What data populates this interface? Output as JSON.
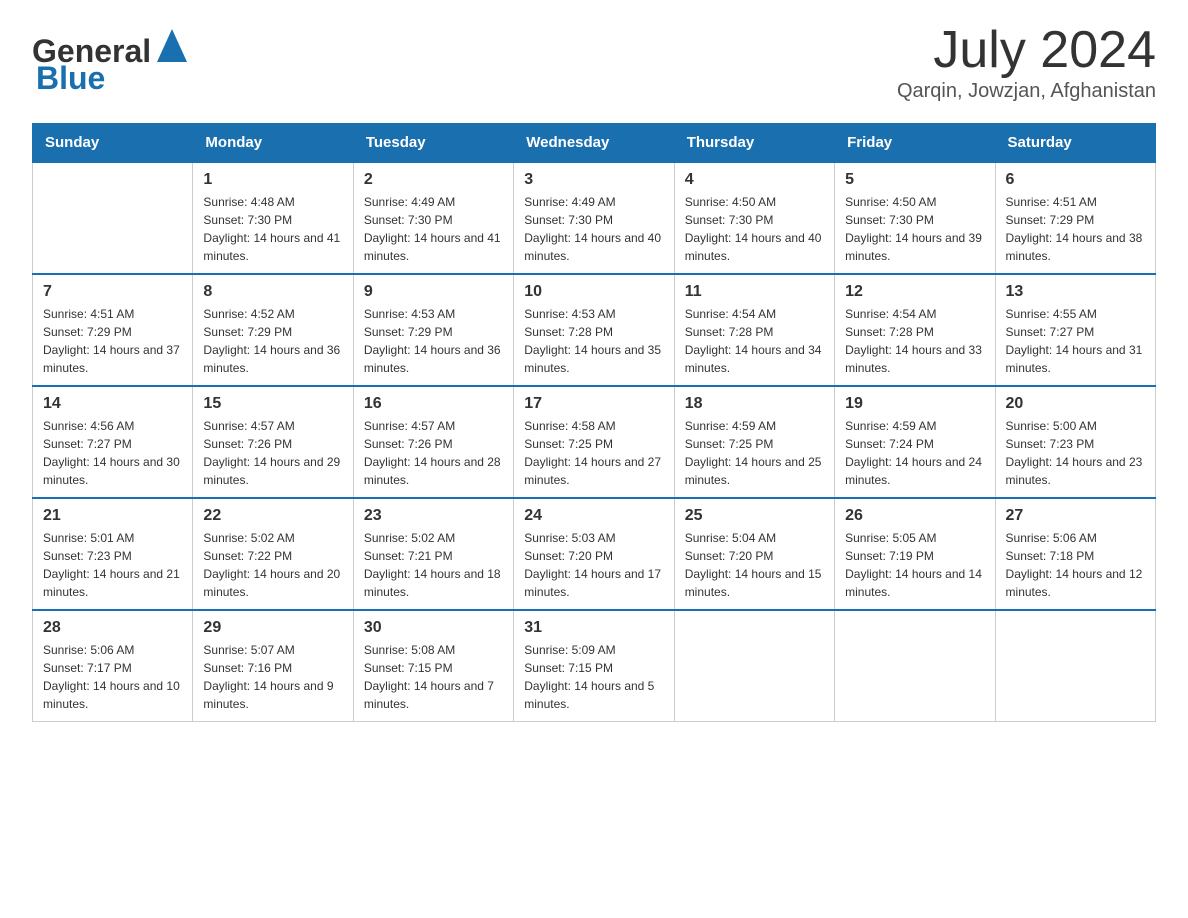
{
  "logo": {
    "text_general": "General",
    "text_blue": "Blue"
  },
  "title": {
    "month_year": "July 2024",
    "location": "Qarqin, Jowzjan, Afghanistan"
  },
  "days_of_week": [
    "Sunday",
    "Monday",
    "Tuesday",
    "Wednesday",
    "Thursday",
    "Friday",
    "Saturday"
  ],
  "weeks": [
    [
      {
        "day": "",
        "sunrise": "",
        "sunset": "",
        "daylight": ""
      },
      {
        "day": "1",
        "sunrise": "Sunrise: 4:48 AM",
        "sunset": "Sunset: 7:30 PM",
        "daylight": "Daylight: 14 hours and 41 minutes."
      },
      {
        "day": "2",
        "sunrise": "Sunrise: 4:49 AM",
        "sunset": "Sunset: 7:30 PM",
        "daylight": "Daylight: 14 hours and 41 minutes."
      },
      {
        "day": "3",
        "sunrise": "Sunrise: 4:49 AM",
        "sunset": "Sunset: 7:30 PM",
        "daylight": "Daylight: 14 hours and 40 minutes."
      },
      {
        "day": "4",
        "sunrise": "Sunrise: 4:50 AM",
        "sunset": "Sunset: 7:30 PM",
        "daylight": "Daylight: 14 hours and 40 minutes."
      },
      {
        "day": "5",
        "sunrise": "Sunrise: 4:50 AM",
        "sunset": "Sunset: 7:30 PM",
        "daylight": "Daylight: 14 hours and 39 minutes."
      },
      {
        "day": "6",
        "sunrise": "Sunrise: 4:51 AM",
        "sunset": "Sunset: 7:29 PM",
        "daylight": "Daylight: 14 hours and 38 minutes."
      }
    ],
    [
      {
        "day": "7",
        "sunrise": "Sunrise: 4:51 AM",
        "sunset": "Sunset: 7:29 PM",
        "daylight": "Daylight: 14 hours and 37 minutes."
      },
      {
        "day": "8",
        "sunrise": "Sunrise: 4:52 AM",
        "sunset": "Sunset: 7:29 PM",
        "daylight": "Daylight: 14 hours and 36 minutes."
      },
      {
        "day": "9",
        "sunrise": "Sunrise: 4:53 AM",
        "sunset": "Sunset: 7:29 PM",
        "daylight": "Daylight: 14 hours and 36 minutes."
      },
      {
        "day": "10",
        "sunrise": "Sunrise: 4:53 AM",
        "sunset": "Sunset: 7:28 PM",
        "daylight": "Daylight: 14 hours and 35 minutes."
      },
      {
        "day": "11",
        "sunrise": "Sunrise: 4:54 AM",
        "sunset": "Sunset: 7:28 PM",
        "daylight": "Daylight: 14 hours and 34 minutes."
      },
      {
        "day": "12",
        "sunrise": "Sunrise: 4:54 AM",
        "sunset": "Sunset: 7:28 PM",
        "daylight": "Daylight: 14 hours and 33 minutes."
      },
      {
        "day": "13",
        "sunrise": "Sunrise: 4:55 AM",
        "sunset": "Sunset: 7:27 PM",
        "daylight": "Daylight: 14 hours and 31 minutes."
      }
    ],
    [
      {
        "day": "14",
        "sunrise": "Sunrise: 4:56 AM",
        "sunset": "Sunset: 7:27 PM",
        "daylight": "Daylight: 14 hours and 30 minutes."
      },
      {
        "day": "15",
        "sunrise": "Sunrise: 4:57 AM",
        "sunset": "Sunset: 7:26 PM",
        "daylight": "Daylight: 14 hours and 29 minutes."
      },
      {
        "day": "16",
        "sunrise": "Sunrise: 4:57 AM",
        "sunset": "Sunset: 7:26 PM",
        "daylight": "Daylight: 14 hours and 28 minutes."
      },
      {
        "day": "17",
        "sunrise": "Sunrise: 4:58 AM",
        "sunset": "Sunset: 7:25 PM",
        "daylight": "Daylight: 14 hours and 27 minutes."
      },
      {
        "day": "18",
        "sunrise": "Sunrise: 4:59 AM",
        "sunset": "Sunset: 7:25 PM",
        "daylight": "Daylight: 14 hours and 25 minutes."
      },
      {
        "day": "19",
        "sunrise": "Sunrise: 4:59 AM",
        "sunset": "Sunset: 7:24 PM",
        "daylight": "Daylight: 14 hours and 24 minutes."
      },
      {
        "day": "20",
        "sunrise": "Sunrise: 5:00 AM",
        "sunset": "Sunset: 7:23 PM",
        "daylight": "Daylight: 14 hours and 23 minutes."
      }
    ],
    [
      {
        "day": "21",
        "sunrise": "Sunrise: 5:01 AM",
        "sunset": "Sunset: 7:23 PM",
        "daylight": "Daylight: 14 hours and 21 minutes."
      },
      {
        "day": "22",
        "sunrise": "Sunrise: 5:02 AM",
        "sunset": "Sunset: 7:22 PM",
        "daylight": "Daylight: 14 hours and 20 minutes."
      },
      {
        "day": "23",
        "sunrise": "Sunrise: 5:02 AM",
        "sunset": "Sunset: 7:21 PM",
        "daylight": "Daylight: 14 hours and 18 minutes."
      },
      {
        "day": "24",
        "sunrise": "Sunrise: 5:03 AM",
        "sunset": "Sunset: 7:20 PM",
        "daylight": "Daylight: 14 hours and 17 minutes."
      },
      {
        "day": "25",
        "sunrise": "Sunrise: 5:04 AM",
        "sunset": "Sunset: 7:20 PM",
        "daylight": "Daylight: 14 hours and 15 minutes."
      },
      {
        "day": "26",
        "sunrise": "Sunrise: 5:05 AM",
        "sunset": "Sunset: 7:19 PM",
        "daylight": "Daylight: 14 hours and 14 minutes."
      },
      {
        "day": "27",
        "sunrise": "Sunrise: 5:06 AM",
        "sunset": "Sunset: 7:18 PM",
        "daylight": "Daylight: 14 hours and 12 minutes."
      }
    ],
    [
      {
        "day": "28",
        "sunrise": "Sunrise: 5:06 AM",
        "sunset": "Sunset: 7:17 PM",
        "daylight": "Daylight: 14 hours and 10 minutes."
      },
      {
        "day": "29",
        "sunrise": "Sunrise: 5:07 AM",
        "sunset": "Sunset: 7:16 PM",
        "daylight": "Daylight: 14 hours and 9 minutes."
      },
      {
        "day": "30",
        "sunrise": "Sunrise: 5:08 AM",
        "sunset": "Sunset: 7:15 PM",
        "daylight": "Daylight: 14 hours and 7 minutes."
      },
      {
        "day": "31",
        "sunrise": "Sunrise: 5:09 AM",
        "sunset": "Sunset: 7:15 PM",
        "daylight": "Daylight: 14 hours and 5 minutes."
      },
      {
        "day": "",
        "sunrise": "",
        "sunset": "",
        "daylight": ""
      },
      {
        "day": "",
        "sunrise": "",
        "sunset": "",
        "daylight": ""
      },
      {
        "day": "",
        "sunrise": "",
        "sunset": "",
        "daylight": ""
      }
    ]
  ]
}
